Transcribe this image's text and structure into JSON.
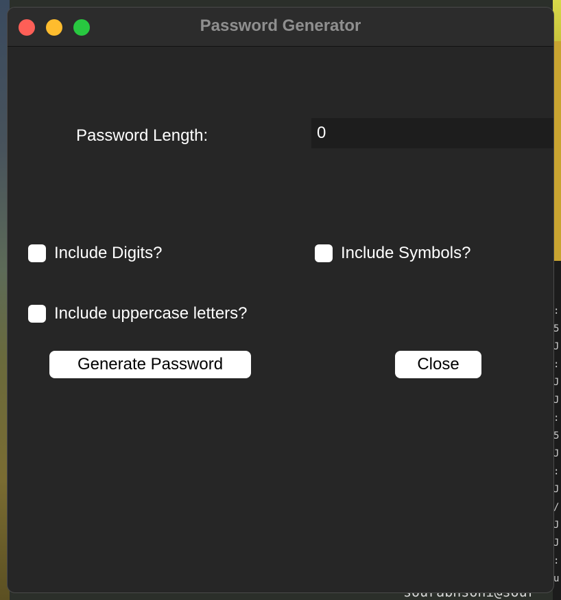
{
  "window": {
    "title": "Password Generator"
  },
  "form": {
    "length_label": "Password Length:",
    "length_value": "0",
    "include_digits_label": "Include Digits?",
    "include_symbols_label": "Include Symbols?",
    "include_uppercase_label": "Include uppercase letters?",
    "include_digits_checked": false,
    "include_symbols_checked": false,
    "include_uppercase_checked": false
  },
  "buttons": {
    "generate_label": "Generate Password",
    "close_label": "Close"
  },
  "background": {
    "terminal_prompt": "sourabhsoni@sour"
  },
  "colors": {
    "window_bg": "#262626",
    "traffic_close": "#fe5f57",
    "traffic_minimize": "#febc2e",
    "traffic_maximize": "#28c840"
  }
}
